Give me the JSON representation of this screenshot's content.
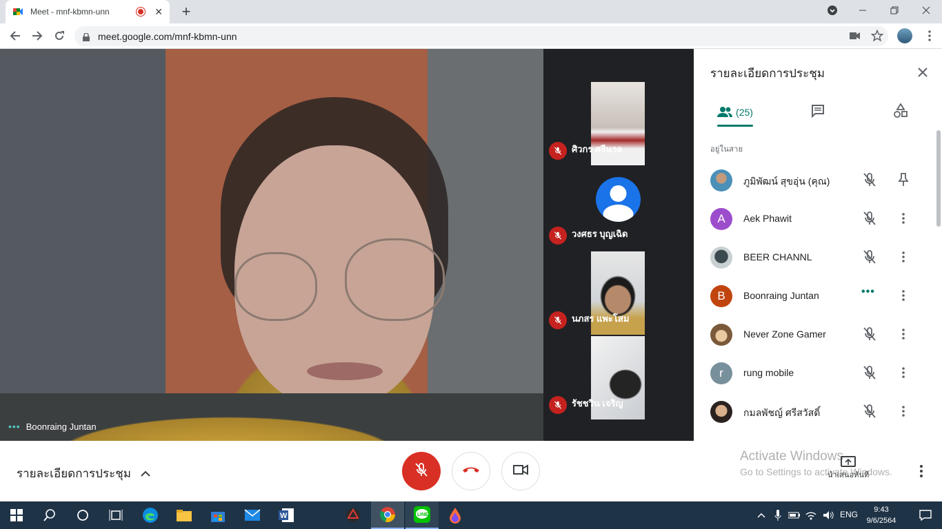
{
  "browser": {
    "tab_title": "Meet - mnf-kbmn-unn",
    "url": "meet.google.com/mnf-kbmn-unn"
  },
  "stage": {
    "main_speaker_name": "Boonraing Juntan",
    "tiles": [
      {
        "name": "ศิวกร ศรีนวล"
      },
      {
        "name": "วงศธร บุญเฉิด"
      },
      {
        "name": "นภสร แพะโสม"
      },
      {
        "name": "รัชชวิน เจริญ"
      }
    ]
  },
  "panel": {
    "title": "รายละเอียดการประชุม",
    "people_count": "(25)",
    "section_label": "อยู่ในสาย",
    "participants": [
      {
        "name": "ภูมิพัฒน์ สุขอุ่น (คุณ)",
        "avatar_letter": "",
        "avatar_color": "#4a90b8",
        "action": "pin"
      },
      {
        "name": "Aek Phawit",
        "avatar_letter": "A",
        "avatar_color": "#9c4dcc",
        "action": "more"
      },
      {
        "name": "BEER CHANNL",
        "avatar_letter": "",
        "avatar_color": "#5f6b6f",
        "action": "more"
      },
      {
        "name": "Boonraing Juntan",
        "avatar_letter": "B",
        "avatar_color": "#c1440e",
        "action": "more",
        "speaking": true
      },
      {
        "name": "Never Zone Gamer",
        "avatar_letter": "",
        "avatar_color": "#7a5a3a",
        "action": "more"
      },
      {
        "name": "rung mobile",
        "avatar_letter": "r",
        "avatar_color": "#78909c",
        "action": "more"
      },
      {
        "name": "กมลพัชญ์ ศรีสวัสดิ์",
        "avatar_letter": "",
        "avatar_color": "#8a6a58",
        "action": "more"
      }
    ]
  },
  "bottom": {
    "meeting_details_label": "รายละเอียดการประชุม",
    "activate_line1": "Activate Windows",
    "activate_line2": "Go to Settings to activate Windows.",
    "present_label": "นำเสนอทันที"
  },
  "taskbar": {
    "lang": "ENG",
    "time": "9:43",
    "date": "9/6/2564"
  },
  "colors": {
    "accent": "#00796b",
    "danger": "#d93025",
    "taskbar": "#1f3347"
  }
}
